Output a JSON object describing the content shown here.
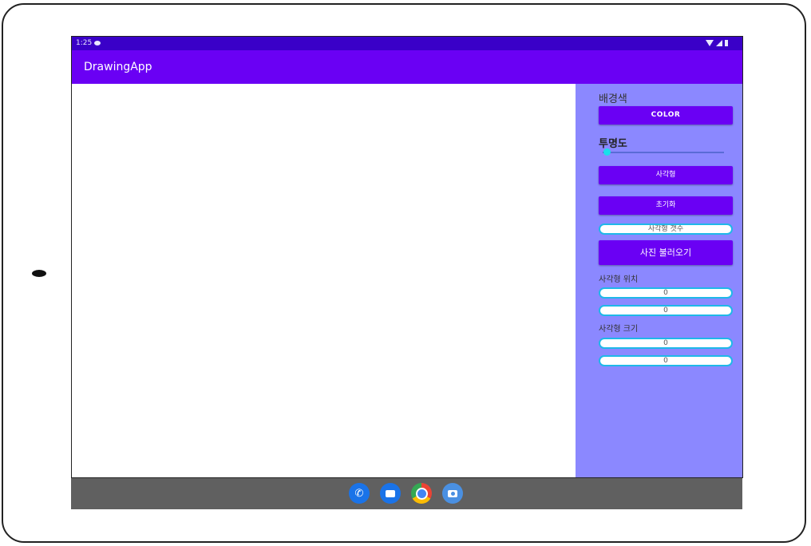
{
  "status_bar": {
    "time": "1:25"
  },
  "app_bar": {
    "title": "DrawingApp"
  },
  "side_panel": {
    "background_label": "배경색",
    "color_button": "COLOR",
    "opacity_label": "투명도",
    "opacity_value": 0,
    "rectangle_button": "사각형",
    "reset_button": "초기화",
    "rect_count_placeholder": "사각형 갯수",
    "load_photo_button": "사진 불러오기",
    "position_label": "사각형 위치",
    "position_x": "0",
    "position_y": "0",
    "size_label": "사각형 크기",
    "size_width": "0",
    "size_height": "0"
  },
  "dock": {
    "icons": [
      "phone-icon",
      "messages-icon",
      "chrome-icon",
      "camera-icon"
    ]
  },
  "colors": {
    "status_bar": "#3a00c8",
    "app_bar": "#6a00f4",
    "side_panel": "#8b88ff",
    "button": "#6a00f4",
    "field_border": "#1fb8e8",
    "nav_bar": "#606060"
  }
}
